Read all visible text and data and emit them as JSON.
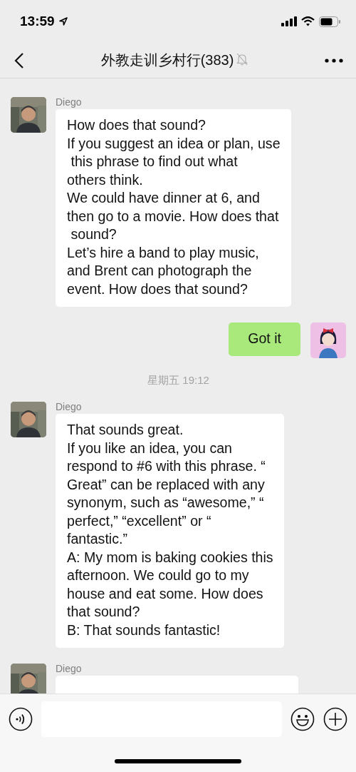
{
  "status_bar": {
    "time": "13:59"
  },
  "header": {
    "title": "外教走训乡村行(383)",
    "muted": true
  },
  "messages": [
    {
      "kind": "incoming",
      "sender": "Diego",
      "text": "How does that sound?\nIf you suggest an idea or plan, use\n this phrase to find out what\nothers think.\nWe could have dinner at 6, and\nthen go to a movie. How does that\n sound?\nLet’s hire a band to play music,\nand Brent can photograph the\nevent. How does that sound?"
    },
    {
      "kind": "outgoing",
      "text": "Got it"
    },
    {
      "kind": "time",
      "text": "星期五 19:12"
    },
    {
      "kind": "incoming",
      "sender": "Diego",
      "text": "That sounds great.\nIf you like an idea, you can\nrespond to #6 with this phrase. “\nGreat” can be replaced with any\nsynonym, such as “awesome,” “\nperfect,” “excellent” or “\nfantastic.”\nA: My mom is baking cookies this\nafternoon. We could go to my\nhouse and eat some. How does\nthat sound?\nB: That sounds fantastic!"
    },
    {
      "kind": "incoming",
      "sender": "Diego"
    }
  ]
}
